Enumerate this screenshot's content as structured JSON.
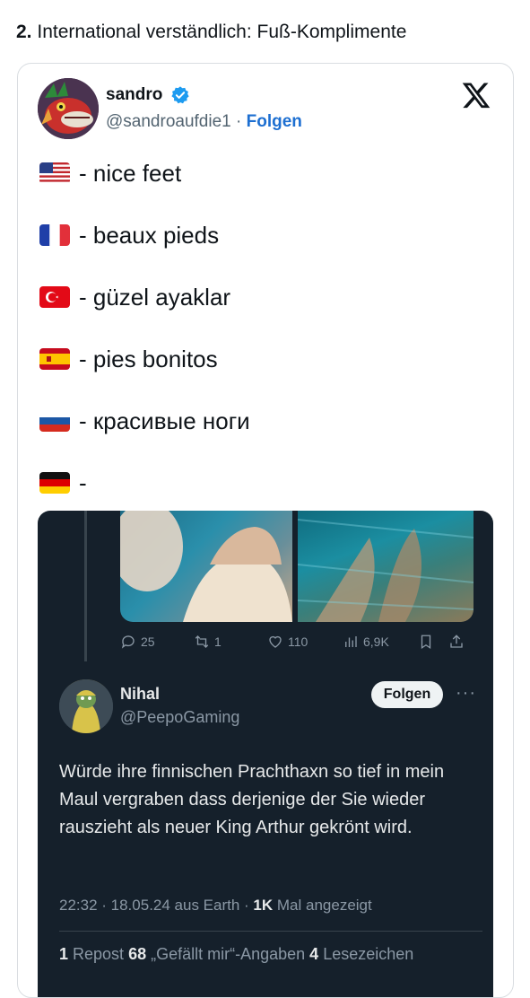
{
  "heading": {
    "number": "2.",
    "title": "International verständlich: Fuß-Komplimente"
  },
  "tweet": {
    "author_name": "sandro",
    "handle": "@sandroaufdie1",
    "separator": " · ",
    "follow_label": "Folgen",
    "lines": [
      {
        "flag": "us",
        "text": "- nice feet"
      },
      {
        "flag": "fr",
        "text": "- beaux pieds"
      },
      {
        "flag": "tr",
        "text": "- güzel ayaklar"
      },
      {
        "flag": "es",
        "text": "- pies bonitos"
      },
      {
        "flag": "ru",
        "text": "- красивые ноги"
      },
      {
        "flag": "de",
        "text": "-"
      }
    ]
  },
  "embedded": {
    "stats": {
      "replies": "25",
      "reposts": "1",
      "likes": "110",
      "views": "6,9K"
    },
    "reply": {
      "name": "Nihal",
      "handle": "@PeepoGaming",
      "follow_label": "Folgen",
      "more": "···",
      "text": "Würde ihre finnischen Prachthaxn so tief in mein Maul vergraben dass derjenige der Sie wieder rauszieht als neuer King Arthur gekrönt wird.",
      "meta_prefix": "22:32 · 18.05.24 aus Earth · ",
      "meta_views": "1K",
      "meta_suffix": " Mal angezeigt",
      "reposts_count": "1",
      "reposts_label": " Repost  ",
      "likes_count": "68",
      "likes_label": " „Gefällt mir“-Angaben  ",
      "bookmarks_count": "4",
      "bookmarks_label": " Lesezeichen"
    }
  },
  "colors": {
    "link_blue": "#1d6fd1",
    "verified_blue": "#1d9bf0",
    "dark_bg": "#15202b"
  }
}
